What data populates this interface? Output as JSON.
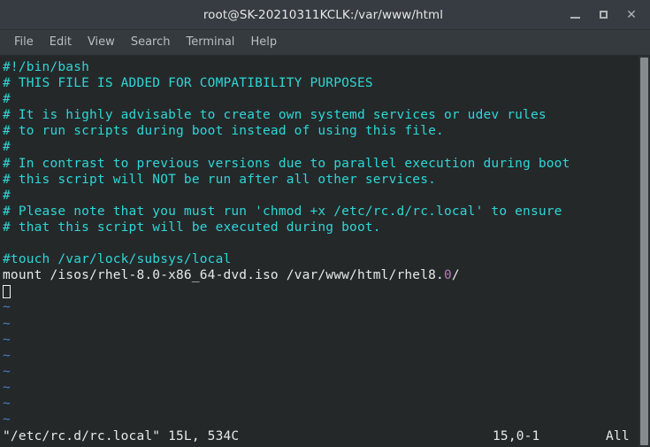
{
  "window": {
    "title": "root@SK-20210311KCLK:/var/www/html",
    "controls": {
      "minimize_label": "–",
      "maximize_label": "□",
      "close_label": "×"
    }
  },
  "menubar": {
    "items": [
      {
        "label": "File"
      },
      {
        "label": "Edit"
      },
      {
        "label": "View"
      },
      {
        "label": "Search"
      },
      {
        "label": "Terminal"
      },
      {
        "label": "Help"
      }
    ]
  },
  "terminal": {
    "lines": [
      {
        "text": "#!/bin/bash",
        "kind": "comment"
      },
      {
        "text": "# THIS FILE IS ADDED FOR COMPATIBILITY PURPOSES",
        "kind": "comment"
      },
      {
        "text": "#",
        "kind": "comment"
      },
      {
        "text": "# It is highly advisable to create own systemd services or udev rules",
        "kind": "comment"
      },
      {
        "text": "# to run scripts during boot instead of using this file.",
        "kind": "comment"
      },
      {
        "text": "#",
        "kind": "comment"
      },
      {
        "text": "# In contrast to previous versions due to parallel execution during boot",
        "kind": "comment"
      },
      {
        "text": "# this script will NOT be run after all other services.",
        "kind": "comment"
      },
      {
        "text": "#",
        "kind": "comment"
      },
      {
        "text": "# Please note that you must run 'chmod +x /etc/rc.d/rc.local' to ensure",
        "kind": "comment"
      },
      {
        "text": "# that this script will be executed during boot.",
        "kind": "comment"
      },
      {
        "text": "",
        "kind": "blank"
      },
      {
        "text": "#touch /var/lock/subsys/local",
        "kind": "comment"
      }
    ],
    "mount_line": {
      "prefix": "mount /isos/rhel-8.0-x86_64-dvd.iso /var/www/html/rhel8.",
      "highlight": "0",
      "suffix": "/"
    },
    "empty_marker": "~",
    "empty_marker_count": 8
  },
  "statusline": {
    "file_info": "\"/etc/rc.d/rc.local\" 15L, 534C",
    "cursor_position": "15,0-1",
    "scroll_position": "All"
  },
  "colors": {
    "titlebar_bg": "#363c41",
    "menubar_bg": "#343a3d",
    "terminal_bg": "#242829",
    "comment": "#2fd6d6",
    "plain_text": "#e6eaea",
    "tilde_blue": "#4a7fc4",
    "number_magenta": "#b97ab5",
    "scrollbar_thumb": "#868c8e"
  }
}
